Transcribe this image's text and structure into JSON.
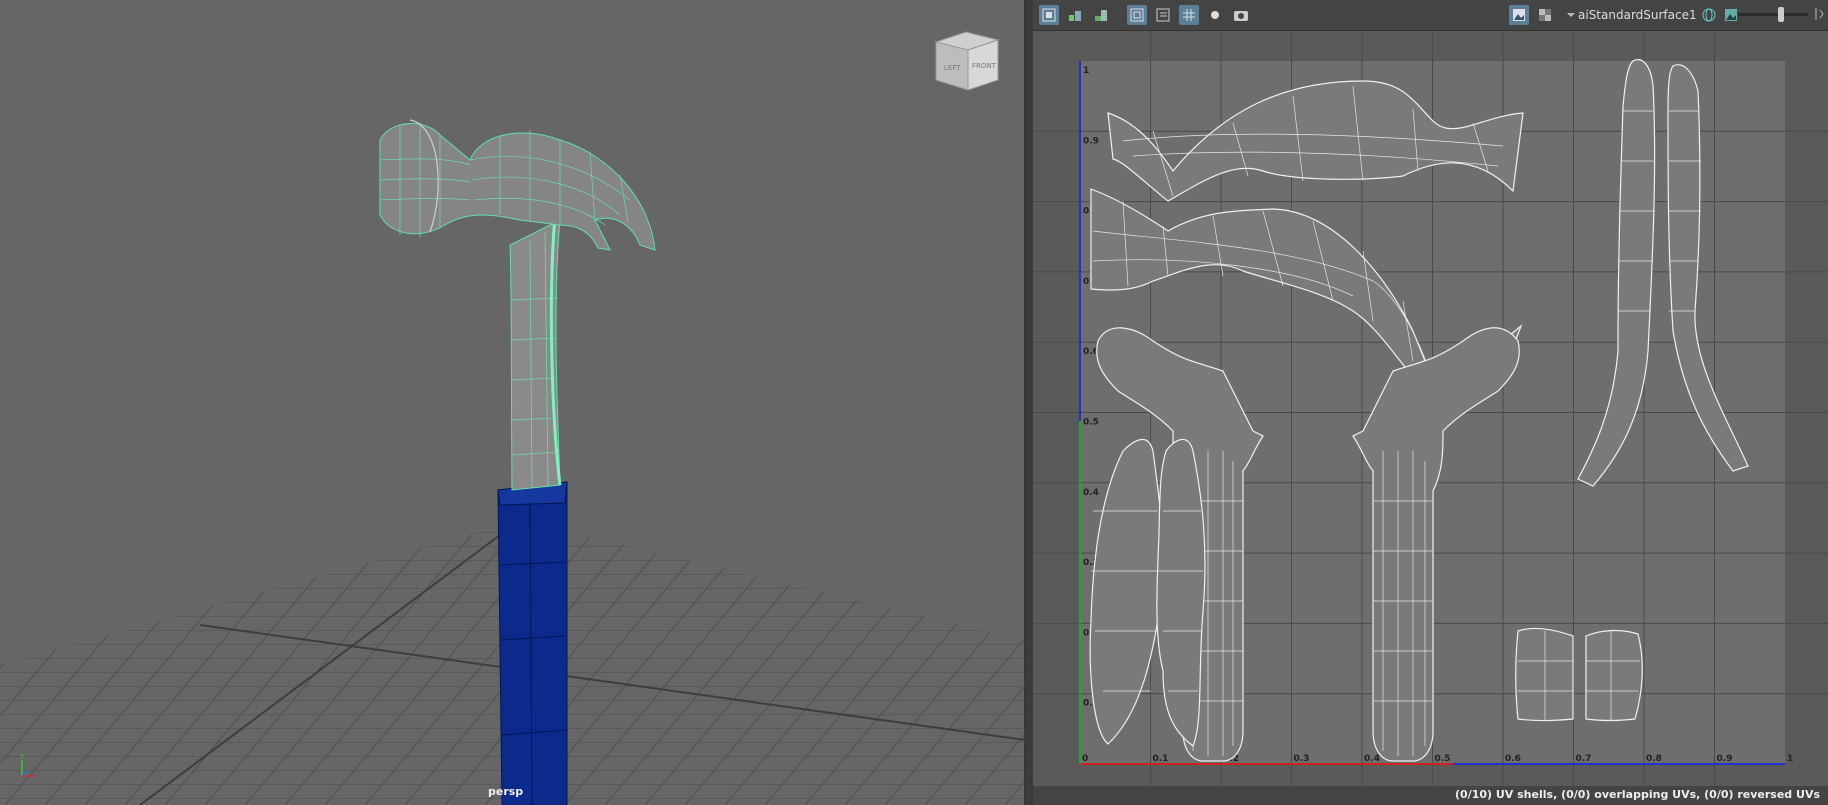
{
  "viewport": {
    "camera_label": "persp",
    "view_cube": {
      "left_face": "LEFT",
      "front_face": "FRONT"
    },
    "axis_gizmo": {
      "y": "Y"
    }
  },
  "uv_editor": {
    "toolbar": {
      "left_buttons": [
        "uv-tool-icon",
        "uv-grid-icon",
        "uv-shaded-icon",
        "uv-frame-icon",
        "uv-list-icon",
        "uv-pixel-snap-icon",
        "uv-sun-icon",
        "uv-snapshot-icon"
      ],
      "material": "aiStandardSurface1"
    },
    "u_ticks": [
      "0",
      "0.1",
      "0.2",
      "0.3",
      "0.4",
      "0.5",
      "0.6",
      "0.7",
      "0.8",
      "0.9",
      "1"
    ],
    "v_ticks": [
      "1",
      "0.9",
      "0.8",
      "0.7",
      "0.6",
      "0.5",
      "0.4",
      "0.3",
      "0.2",
      "0.1"
    ],
    "status": "(0/10) UV shells, (0/0) overlapping UVs, (0/0) reversed UVs"
  },
  "colors": {
    "viewport_bg": "#666666",
    "uv_bg": "#5a5a5a",
    "selection": "#5fe0a8",
    "handle_blue": "#0b2a8c",
    "u_axis": "#cc2222",
    "v_axis": "#22aa22"
  }
}
